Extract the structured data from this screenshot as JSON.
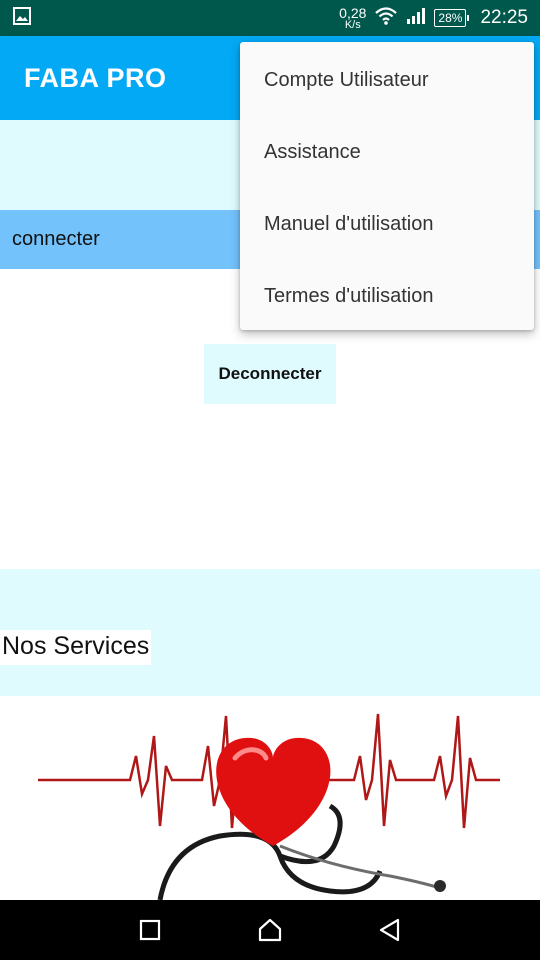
{
  "status_bar": {
    "net_speed_value": "0,28",
    "net_speed_unit": "K/s",
    "battery": "28%",
    "time": "22:25",
    "icons": [
      "image-notification-icon",
      "wifi-icon",
      "cell-signal-icon",
      "battery-icon"
    ]
  },
  "app_bar": {
    "title": "FABA PRO"
  },
  "connect_strip": {
    "label": "connecter"
  },
  "disconnect_button": {
    "label": "Deconnecter"
  },
  "services": {
    "title": "Nos Services"
  },
  "menu": {
    "items": [
      {
        "label": "Compte Utilisateur"
      },
      {
        "label": "Assistance"
      },
      {
        "label": "Manuel d'utilisation"
      },
      {
        "label": "Termes d'utilisation"
      }
    ]
  },
  "nav_bar": {
    "icons": [
      "recents-icon",
      "home-icon",
      "back-icon"
    ]
  },
  "colors": {
    "status_bar": "#00574b",
    "app_bar": "#03a9f4",
    "light_cyan": "#e0fbfd",
    "strip_blue": "#73c2fb",
    "menu_bg": "#fafafa",
    "heart_red": "#e01010"
  }
}
